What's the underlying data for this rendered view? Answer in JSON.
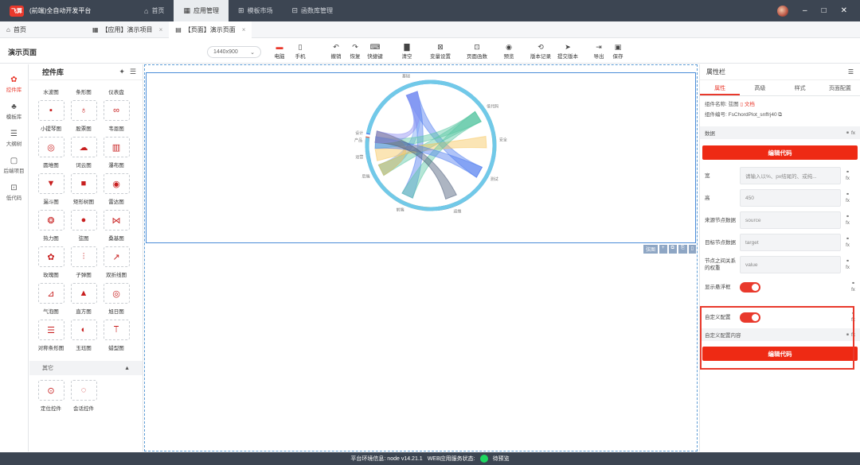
{
  "app": {
    "logo_text": "飞算",
    "title": "(前端)全自动开发平台"
  },
  "topnav": [
    {
      "icon": "⌂",
      "label": "首页"
    },
    {
      "icon": "▦",
      "label": "应用管理"
    },
    {
      "icon": "⊞",
      "label": "模板市场"
    },
    {
      "icon": "⊟",
      "label": "函数库管理"
    }
  ],
  "window_controls": {
    "min": "–",
    "max": "□",
    "close": "✕"
  },
  "tabs": {
    "home": "首页",
    "items": [
      {
        "icon": "▦",
        "label": "【应用】演示项目"
      },
      {
        "icon": "▤",
        "label": "【页面】演示页面"
      }
    ]
  },
  "toolbar": {
    "page_title": "演示页面",
    "size": "1440x900",
    "tools": [
      "电脑",
      "手机",
      "撤销",
      "恢复",
      "快捷键",
      "清空",
      "变量设置",
      "页面函数",
      "预览",
      "版本记录",
      "提交版本",
      "导出",
      "保存"
    ]
  },
  "leftnav": [
    "控件库",
    "模板库",
    "大纲树",
    "后端项目",
    "低代码"
  ],
  "panel": {
    "title": "控件库",
    "top_labels": [
      "水波图",
      "条形图",
      "仪表盘"
    ],
    "components": [
      {
        "icon": "▪",
        "label": "小提琴图"
      },
      {
        "icon": "♁",
        "label": "股票图"
      },
      {
        "icon": "∞",
        "label": "韦恩图"
      },
      {
        "icon": "◎",
        "label": "圆堆图"
      },
      {
        "icon": "☁",
        "label": "词云图"
      },
      {
        "icon": "▥",
        "label": "瀑布图"
      },
      {
        "icon": "▼",
        "label": "漏斗图"
      },
      {
        "icon": "■",
        "label": "矩形树图"
      },
      {
        "icon": "◉",
        "label": "雷达图"
      },
      {
        "icon": "❂",
        "label": "热力图"
      },
      {
        "icon": "●",
        "label": "弦图"
      },
      {
        "icon": "⋈",
        "label": "桑基图"
      },
      {
        "icon": "✿",
        "label": "玫瑰图"
      },
      {
        "icon": "⫶",
        "label": "子弹图"
      },
      {
        "icon": "↗",
        "label": "双折线图"
      },
      {
        "icon": "⊿",
        "label": "气泡图"
      },
      {
        "icon": "▲",
        "label": "直方图"
      },
      {
        "icon": "◎",
        "label": "旭日图"
      },
      {
        "icon": "☰",
        "label": "对称条形图"
      },
      {
        "icon": "◐",
        "label": "玉珏图"
      },
      {
        "icon": "⟙",
        "label": "蜡型图"
      }
    ],
    "section_other": "其它",
    "other_components": [
      {
        "icon": "⊙",
        "label": "定位控件"
      },
      {
        "icon": "◌",
        "label": "会话控件"
      }
    ]
  },
  "chart": {
    "labels": [
      "基础",
      "低代码",
      "安全",
      "测试",
      "运维",
      "前端",
      "后端",
      "运营",
      "产品",
      "设计"
    ],
    "colors": [
      "#4f7df0",
      "#5cc8a3",
      "#f7c55b",
      "#8d8df2",
      "#4a5a78",
      "#f2ab4a",
      "#7ba7f7",
      "#a26ad9",
      "#e76b57",
      "#71c9e8"
    ],
    "tag": "弦图"
  },
  "rpanel": {
    "title": "属性栏",
    "tabs": [
      "属性",
      "高级",
      "样式",
      "页面配置"
    ],
    "comp_name_label": "组件名称:",
    "comp_name": "弦图",
    "doc_link": "文档",
    "comp_id_label": "组件编号:",
    "comp_id": "FsChordPlot_snffrj40",
    "data_section": "数据",
    "edit_code": "编辑代码",
    "fields": [
      {
        "label": "宽",
        "value": "",
        "placeholder": "请输入以%、px结尾的、或纯..."
      },
      {
        "label": "高",
        "value": "450",
        "placeholder": ""
      },
      {
        "label": "来源节点数据",
        "value": "source",
        "placeholder": ""
      },
      {
        "label": "目标节点数据",
        "value": "target",
        "placeholder": ""
      },
      {
        "label": "节点之间关系的权重",
        "value": "value",
        "placeholder": ""
      }
    ],
    "show_tooltip": "显示悬浮框",
    "custom_config": "自定义配置",
    "custom_content": "自定义配置内容",
    "edit_code2": "编辑代码"
  },
  "status": {
    "env": "平台环境信息: node v14.21.1",
    "web": "WEB应用服务状态:",
    "state": "待预览"
  }
}
